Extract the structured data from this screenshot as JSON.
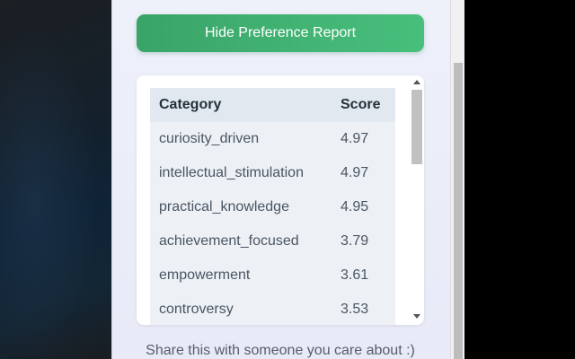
{
  "toggle_button": {
    "label": "Hide Preference Report"
  },
  "report": {
    "headers": {
      "category": "Category",
      "score": "Score"
    },
    "rows": [
      {
        "category": "curiosity_driven",
        "score": "4.97"
      },
      {
        "category": "intellectual_stimulation",
        "score": "4.97"
      },
      {
        "category": "practical_knowledge",
        "score": "4.95"
      },
      {
        "category": "achievement_focused",
        "score": "3.79"
      },
      {
        "category": "empowerment",
        "score": "3.61"
      },
      {
        "category": "controversy",
        "score": "3.53"
      },
      {
        "category": "",
        "score": ""
      }
    ]
  },
  "footer": {
    "share_text": "Share this with someone you care about :)"
  }
}
